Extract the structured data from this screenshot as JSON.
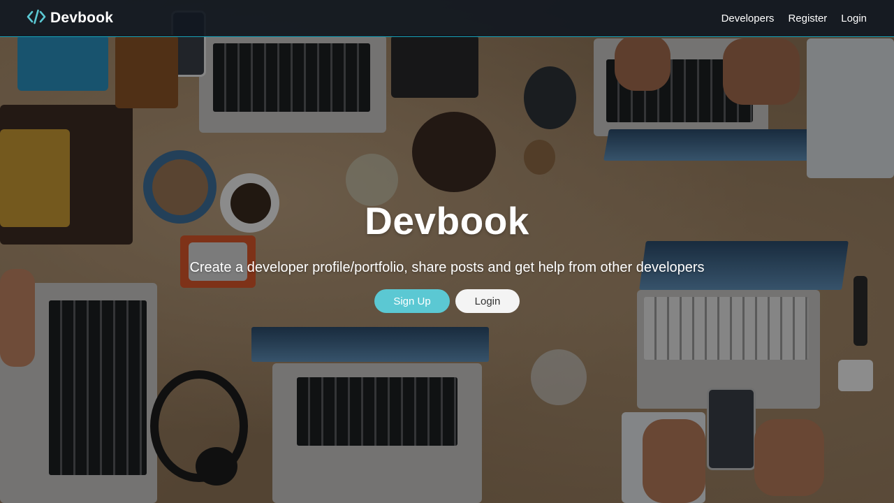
{
  "navbar": {
    "brand_icon": "code-icon",
    "brand_text": "Devbook",
    "links": [
      "Developers",
      "Register",
      "Login"
    ]
  },
  "hero": {
    "title": "Devbook",
    "subtitle": "Create a developer profile/portfolio, share posts and get help from other developers",
    "signup_label": "Sign Up",
    "login_label": "Login"
  },
  "colors": {
    "accent": "#5bc8d3",
    "navbar_bg": "#111821",
    "navbar_border": "#17a2b8"
  }
}
